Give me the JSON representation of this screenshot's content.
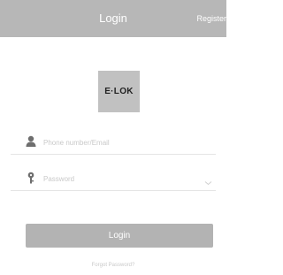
{
  "header": {
    "title": "Login",
    "register_label": "Register"
  },
  "logo": {
    "text": "E·LOK"
  },
  "form": {
    "phone_placeholder": "Phone number/Email",
    "password_placeholder": "Password"
  },
  "login_button": {
    "label": "Login"
  },
  "forgot_link": {
    "label": "Forgot Password?"
  },
  "icons": {
    "phone_field": "user-icon",
    "password_field": "key-icon",
    "password_toggle": "chevron-down-icon"
  },
  "colors": {
    "header_bg": "#b7b7b7",
    "logo_bg": "#c1c1c1",
    "button_bg": "#b3b3b3",
    "placeholder": "#c9c9c9"
  }
}
